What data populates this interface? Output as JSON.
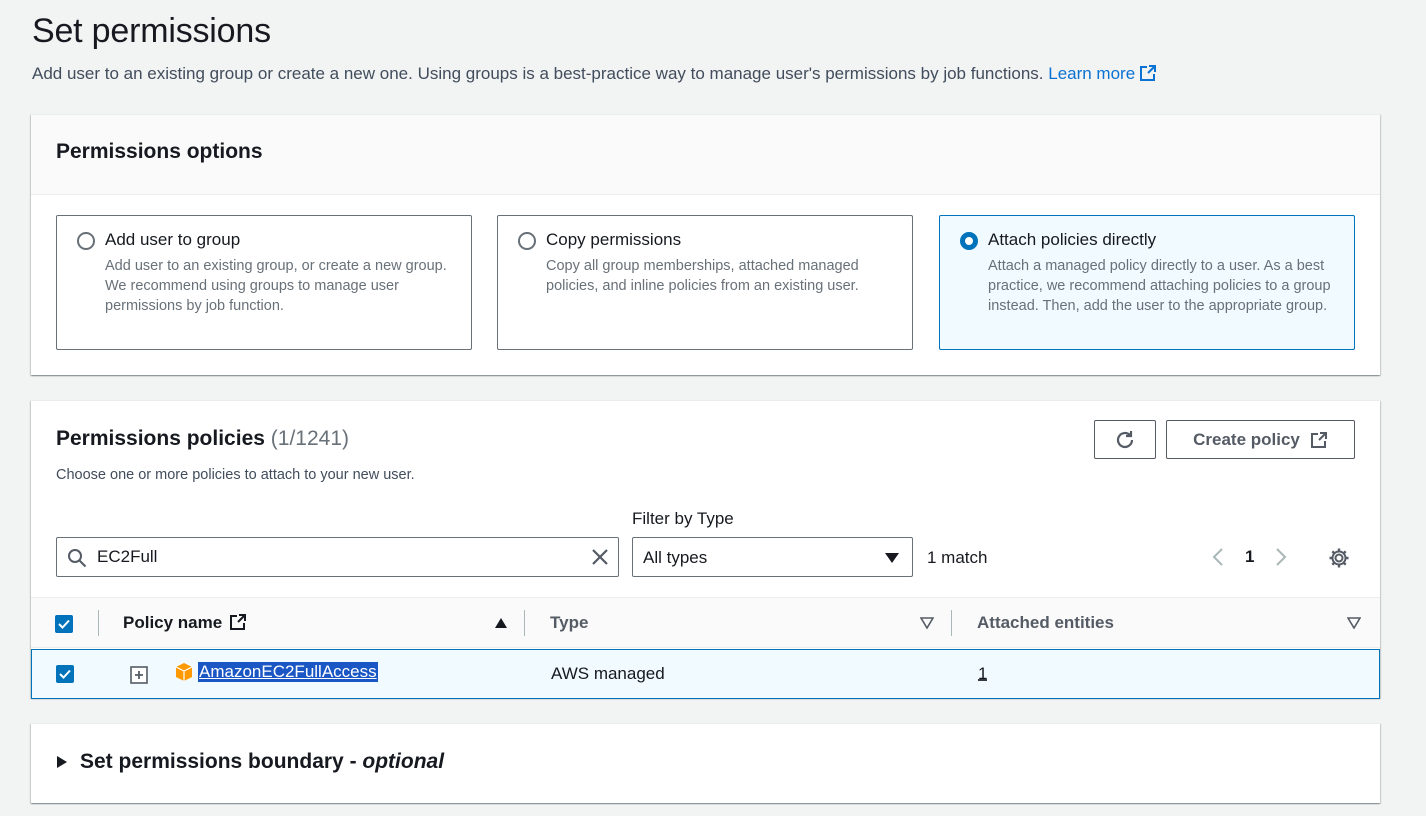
{
  "header": {
    "title": "Set permissions",
    "description": "Add user to an existing group or create a new one. Using groups is a best-practice way to manage user's permissions by job functions.",
    "learn_more": "Learn more"
  },
  "options": {
    "title": "Permissions options",
    "cards": [
      {
        "label": "Add user to group",
        "desc": "Add user to an existing group, or create a new group. We recommend using groups to manage user permissions by job function.",
        "selected": false
      },
      {
        "label": "Copy permissions",
        "desc": "Copy all group memberships, attached managed policies, and inline policies from an existing user.",
        "selected": false
      },
      {
        "label": "Attach policies directly",
        "desc": "Attach a managed policy directly to a user. As a best practice, we recommend attaching policies to a group instead. Then, add the user to the appropriate group.",
        "selected": true
      }
    ]
  },
  "policies": {
    "title": "Permissions policies",
    "count": "(1/1241)",
    "description": "Choose one or more policies to attach to your new user.",
    "create_button": "Create policy",
    "filter_label": "Filter by Type",
    "search_value": "EC2Full",
    "filter_value": "All types",
    "match_text": "1 match",
    "page_number": "1",
    "columns": {
      "name": "Policy name",
      "type": "Type",
      "entities": "Attached entities"
    },
    "rows": [
      {
        "name": "AmazonEC2FullAccess",
        "type": "AWS managed",
        "entities": "1",
        "checked": true
      }
    ]
  },
  "boundary": {
    "title": "Set permissions boundary -",
    "optional": "optional"
  },
  "colors": {
    "accent": "#0073bb",
    "link": "#0972d3",
    "selected_bg": "#f1faff",
    "aws_orange": "#f90"
  },
  "icons": [
    "external-link-icon",
    "refresh-icon",
    "search-icon",
    "clear-icon",
    "caret-down-icon",
    "chevron-left-icon",
    "chevron-right-icon",
    "gear-icon",
    "checkbox-checked-icon",
    "sort-asc-icon",
    "sort-icon",
    "expand-icon",
    "aws-package-icon",
    "triangle-right-icon"
  ]
}
